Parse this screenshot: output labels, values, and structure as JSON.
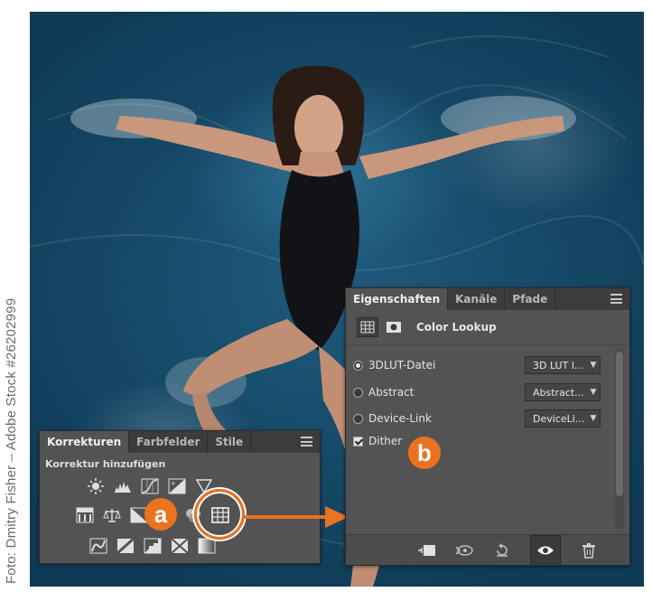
{
  "credit": "Foto: Dmitry Fisher – Adobe Stock #26202999",
  "korrekturen_panel": {
    "tabs": [
      "Korrekturen",
      "Farbfelder",
      "Stile"
    ],
    "subtitle": "Korrektur hinzufügen",
    "row1_icons": [
      "brightness-contrast-icon",
      "levels-icon",
      "curves-icon",
      "exposure-icon",
      "vibrance-icon"
    ],
    "row2_icons": [
      "hue-saturation-icon",
      "color-balance-icon",
      "black-white-icon",
      "photo-filter-icon",
      "channel-mixer-icon",
      "color-lookup-icon"
    ],
    "row3_icons": [
      "invert-icon",
      "posterize-icon",
      "threshold-icon",
      "selective-color-icon",
      "gradient-map-icon"
    ]
  },
  "eigenschaften_panel": {
    "tabs": [
      "Eigenschaften",
      "Kanäle",
      "Pfade"
    ],
    "title": "Color Lookup",
    "options": [
      {
        "label": "3DLUT-Datei",
        "selected": true,
        "dropdown": "3D LUT l..."
      },
      {
        "label": "Abstract",
        "selected": false,
        "dropdown": "Abstract..."
      },
      {
        "label": "Device-Link",
        "selected": false,
        "dropdown": "DeviceLi..."
      }
    ],
    "dither": {
      "label": "Dither",
      "checked": true
    },
    "footer_icons": [
      "clip-to-layer-icon",
      "view-previous-state-icon",
      "reset-icon",
      "visibility-eye-icon",
      "trash-icon"
    ]
  },
  "callouts": {
    "a": "a",
    "b": "b"
  },
  "colors": {
    "accent": "#e9731e",
    "panel": "#535353",
    "tabbar": "#3c3c3c",
    "water": "#1e5a7c"
  }
}
